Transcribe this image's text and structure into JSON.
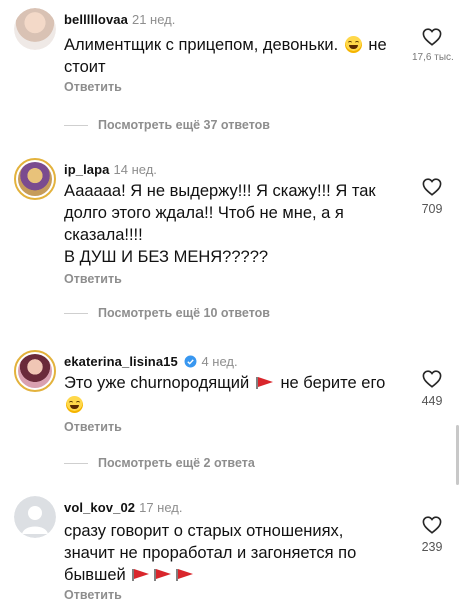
{
  "reply_label": "Ответить",
  "comments": [
    {
      "username": "belllllovaa",
      "time": "21 нед.",
      "line1_a": "Алиментщик с прицепом, девоньки.",
      "line1_b": "не",
      "line2": "стоит",
      "likes": "17,6 тыс.",
      "more_label": "Посмотреть ещё 37 ответов"
    },
    {
      "username": "ip_lapa",
      "time": "14 нед.",
      "line1": "Аааааа! Я не выдержу!!! Я скажу!!! Я так",
      "line2": "долго этого ждала!! Чтоб не мне, а я",
      "line3": "сказала!!!!",
      "line4": "В ДУШ И БЕЗ МЕНЯ?????",
      "likes": "709",
      "more_label": "Посмотреть ещё 10 ответов"
    },
    {
      "username": "ekaterina_lisina15",
      "time": "4 нед.",
      "line1_a": "Это уже churnородящий",
      "line1_b": "не берите его",
      "likes": "449",
      "more_label": "Посмотреть ещё 2 ответа"
    },
    {
      "username": "vol_kov_02",
      "time": "17 нед.",
      "line1": "сразу говорит о старых отношениях,",
      "line2": "значит не проработал и загоняется по",
      "line3": "бывшей",
      "likes": "239"
    }
  ],
  "icons": {
    "like": "heart-outline-icon",
    "verified": "verified-badge-icon",
    "emoji": "laughing-emoji-icon",
    "flag": "red-flag-icon"
  },
  "colors": {
    "muted": "#8e8e8e",
    "verified": "#3897f0",
    "flag": "#d9262c",
    "story_ring": "#e3b23c"
  }
}
